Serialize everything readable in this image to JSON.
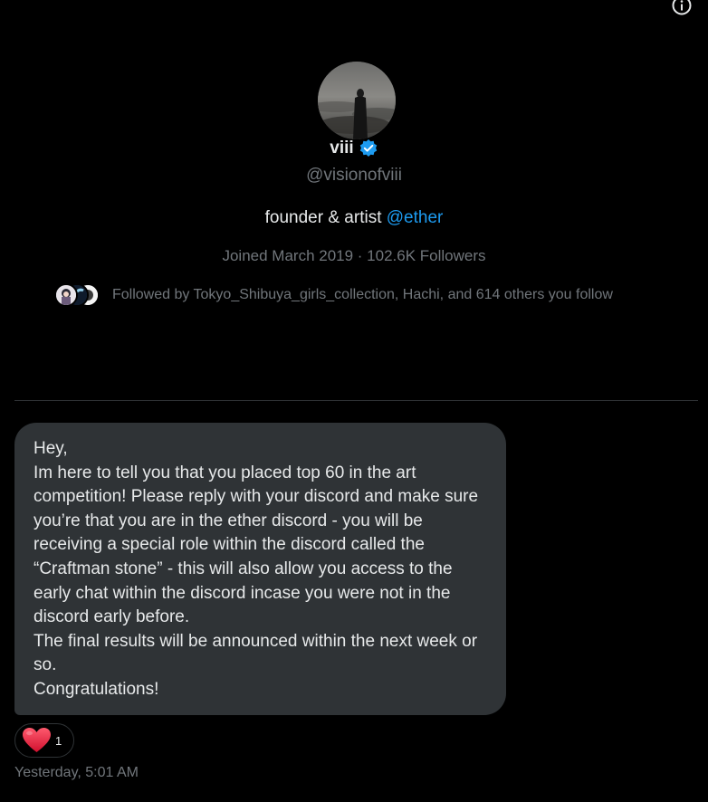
{
  "profile": {
    "display_name": "viii",
    "handle": "@visionofviii",
    "bio_text": "founder & artist ",
    "bio_mention": "@ether",
    "meta": "Joined March 2019 · 102.6K Followers",
    "followed_by": "Followed by Tokyo_Shibuya_girls_collection, Hachi, and 614 others you follow"
  },
  "message": {
    "lines": [
      "Hey,",
      "Im here to tell you that you placed top 60 in the art competition! Please reply with your discord and make sure you’re that you are in the ether discord - you will be receiving a special role within the discord called the “Craftman stone” - this will also allow you access to the early chat within the discord incase you were not in the discord early before.",
      "The final results will be announced within the next week or so.",
      "Congratulations!"
    ],
    "reaction_count": "1",
    "timestamp": "Yesterday, 5:01 AM"
  },
  "icons": {
    "info": "info-icon",
    "verified": "verified-badge-icon",
    "reaction": "heart-icon"
  },
  "colors": {
    "background": "#000000",
    "accent": "#1d9bf0",
    "bubble": "#2f3336",
    "muted_text": "#71767b",
    "heart": "#f91880"
  }
}
